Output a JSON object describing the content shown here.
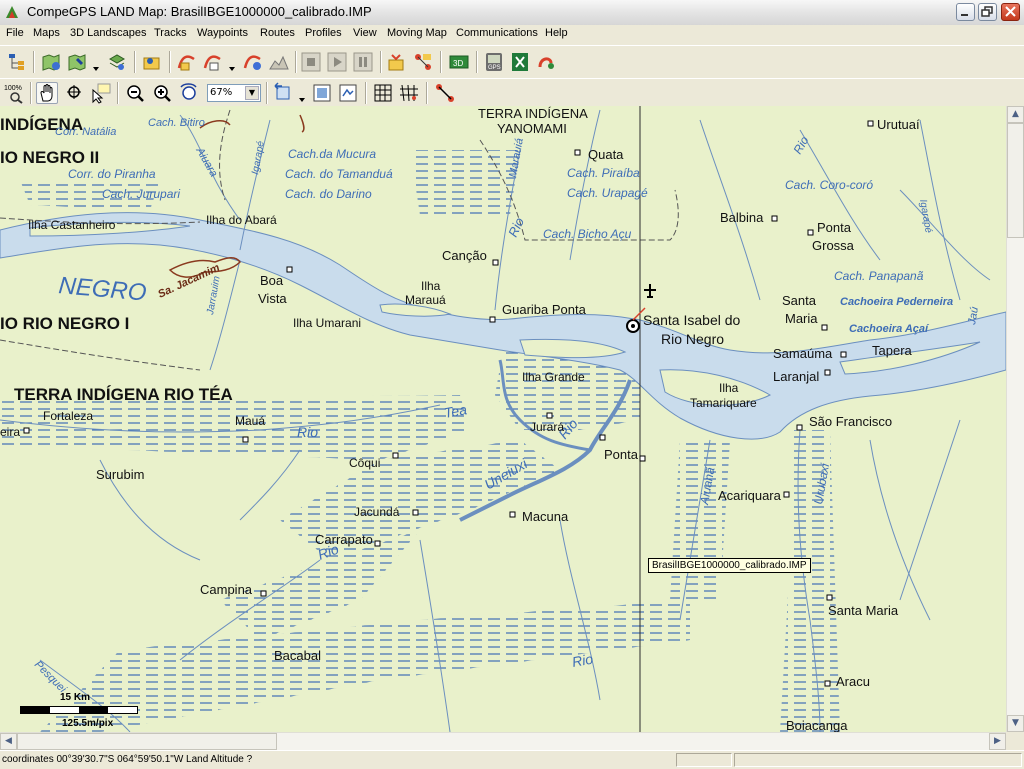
{
  "window": {
    "title": "CompeGPS LAND Map: BrasilIBGE1000000_calibrado.IMP"
  },
  "menu": [
    "File",
    "Maps",
    "3D Landscapes",
    "Tracks",
    "Waypoints",
    "Routes",
    "Profiles",
    "View",
    "Moving Map",
    "Communications",
    "Help"
  ],
  "toolbar": {
    "zoom_value": "67%",
    "zoom_100_label": "100%"
  },
  "map": {
    "tooltip": "BrasilIBGE1000000_calibrado.IMP",
    "scale_top": "15 Km",
    "scale_bottom": "125.5m/pix",
    "labels": {
      "indigena_top_left": "INDÍGENA",
      "rio_negro_ii": "IO NEGRO II",
      "corr_natalia": "Corr. Natália",
      "corr_piranha": "Corr. do Piranha",
      "cach_jurupari": "Cach. Jurupari",
      "cach_bitiro": "Cach. Bitiro",
      "aiuara": "Aiuara",
      "igarape": "Igarapé",
      "cach_mucura": "Cach.da Mucura",
      "cach_tamandua": "Cach. do Tamanduá",
      "cach_darino": "Cach. do Darino",
      "terra_indigena_yanomami_1": "TERRA INDÍGENA",
      "terra_indigena_yanomami_2": "YANOMAMI",
      "quata": "Quata",
      "marauia": "Marauiá",
      "cach_piraiba": "Cach. Piraíba",
      "cach_urapage": "Cach. Urapagé",
      "cach_bicho_acu": "Cach. Bicho Açu",
      "rio_marauia": "Rio",
      "urutuai": "Urutuaí",
      "rio_top_right": "Rio",
      "cach_coro_coro": "Cach. Coro-coró",
      "balbina": "Balbina",
      "ponta_grossa_1": "Ponta",
      "ponta_grossa_2": "Grossa",
      "igarape_right": "Igarapé",
      "cach_panapana": "Cach. Panapanã",
      "cachoeira_pederneira": "Cachoeira Pederneira",
      "santa_maria_1": "Santa",
      "santa_maria_2": "Maria",
      "cachoeira_acai": "Cachoeira Açaí",
      "jau": "Jaú",
      "ilha_castanheiro": "Ilha Castanheiro",
      "ilha_do_abara": "Ilha do Abará",
      "cancao": "Canção",
      "negro": "NEGRO",
      "sa_jacamim": "Sa. Jacamim",
      "boa_vista_1": "Boa",
      "boa_vista_2": "Vista",
      "jarrauim": "Jarrauim",
      "ilha_maraua_1": "Ilha",
      "ilha_maraua_2": "Marauá",
      "ilha_umarani": "Ilha Umarani",
      "guariba_ponta": "Guariba Ponta",
      "santa_isabel_1": "Santa Isabel do",
      "santa_isabel_2": "Rio Negro",
      "samauma": "Samaúma",
      "tapera": "Tapera",
      "laranjal": "Laranjal",
      "rio_negro_i": "IO RIO NEGRO I",
      "terra_indigena_rio_tea": "TERRA INDÍGENA RIO TÉA",
      "ilha_grande": "Ilha Grande",
      "ilha_tamariquare_1": "Ilha",
      "ilha_tamariquare_2": "Tamariquare",
      "sao_francisco": "São Francisco",
      "fortaleza": "Fortaleza",
      "maua": "Mauá",
      "tea": "Tea",
      "rio_tea": "Rio",
      "jurara": "Jurará",
      "eira": "eira",
      "coqui": "Côqui",
      "ponta": "Ponta",
      "surubim": "Surubim",
      "uneiuxi": "Uneiuxi",
      "rio_uneiuxi": "Rio",
      "aiuana": "Aiuanã",
      "acariquara": "Acariquara",
      "urubaxi": "Urubaxi",
      "jacunda": "Jacundá",
      "macuna": "Macuna",
      "carrapato": "Carrapato",
      "rio_carrapato": "Rio",
      "campina": "Campina",
      "santa_maria_s": "Santa Maria",
      "rio_bottom": "Rio",
      "bacabal": "Bacabal",
      "aracu": "Aracu",
      "pesquei": "Pesquei",
      "boiacanga": "Boiacanga"
    }
  },
  "status": {
    "text": "coordinates 00°39'30.7\"S 064°59'50.1\"W Land Altitude ?"
  }
}
